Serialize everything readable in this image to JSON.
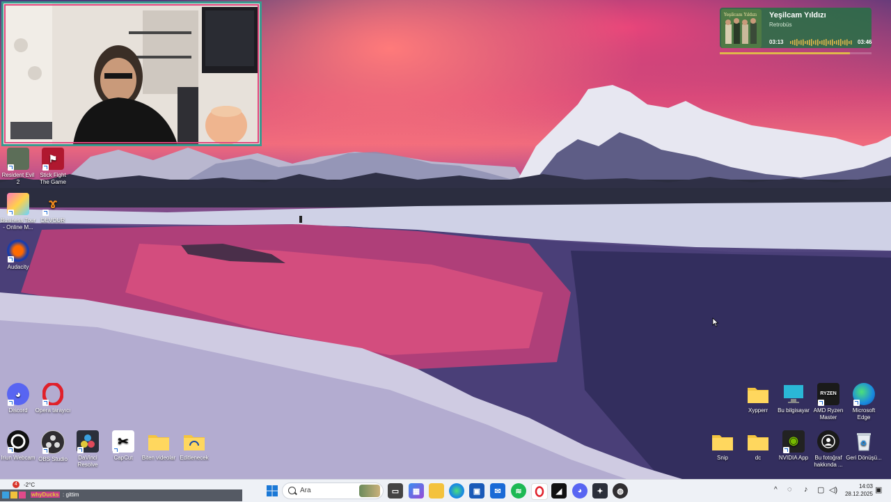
{
  "now_playing": {
    "title": "Yeşilcam Yıldızı",
    "artist": "Retrobüs",
    "current_time": "03:13",
    "total_time": "03:46",
    "progress": 0.86,
    "art_text": "Yeşilcam Yıldızı"
  },
  "desktop_icons_left": [
    {
      "label": "Resident Evil 2",
      "icon": "resident-evil-icon"
    },
    {
      "label": "Stick Fight The Game",
      "icon": "stick-fight-icon"
    },
    {
      "label": "Business Tour - Online M...",
      "icon": "business-tour-icon"
    },
    {
      "label": "DEVOUR",
      "icon": "devour-icon"
    },
    {
      "label": "Audacity",
      "icon": "audacity-icon"
    }
  ],
  "desktop_icons_bottom_left": [
    {
      "label": "Discord",
      "icon": "discord-icon"
    },
    {
      "label": "Opera tarayıcı",
      "icon": "opera-icon"
    },
    {
      "label": "Iriun Webcam",
      "icon": "iriun-webcam-icon"
    },
    {
      "label": "OBS Studio",
      "icon": "obs-icon"
    },
    {
      "label": "DaVinci Resolve",
      "icon": "davinci-icon"
    },
    {
      "label": "CapCut",
      "icon": "capcut-icon"
    },
    {
      "label": "Biten videolar",
      "icon": "folder-icon"
    },
    {
      "label": "Editlenecek",
      "icon": "folder-icon"
    }
  ],
  "desktop_icons_right": [
    {
      "label": "Xypperr",
      "icon": "folder-icon"
    },
    {
      "label": "Bu bilgisayar",
      "icon": "this-pc-icon"
    },
    {
      "label": "AMD Ryzen Master",
      "icon": "ryzen-master-icon",
      "badge": "RYZEN"
    },
    {
      "label": "Microsoft Edge",
      "icon": "edge-icon"
    },
    {
      "label": "Snip",
      "icon": "folder-icon"
    },
    {
      "label": "dc",
      "icon": "folder-icon"
    },
    {
      "label": "NVIDIA App",
      "icon": "nvidia-icon"
    },
    {
      "label": "Bu fotoğraf hakkında ...",
      "icon": "photo-info-icon"
    },
    {
      "label": "Geri Dönüşü...",
      "icon": "recycle-bin-icon"
    }
  ],
  "taskbar": {
    "search_placeholder": "Ara",
    "weather_badge": "4",
    "weather_temp": "-2°C",
    "chat_user": "whyDucks",
    "chat_message": ": gittim",
    "apps": [
      "start-icon",
      "search-icon",
      "task-view-icon",
      "ms-store-icon",
      "file-explorer-icon",
      "edge-icon",
      "microsoft-store-icon",
      "outlook-icon",
      "spotify-icon",
      "opera-icon",
      "capcut-icon",
      "discord-icon",
      "davinci-icon",
      "obs-icon"
    ],
    "tray_chevron": "^",
    "clock_time": "14:03",
    "clock_date": "28.12.2025"
  },
  "colors": {
    "webcam_border": "#3a9a8f",
    "webcam_accent": "#e0457b",
    "np_bg": "#2c6e46",
    "np_progress": "#e0b84a",
    "taskbar_bg": "#eef1f6"
  }
}
